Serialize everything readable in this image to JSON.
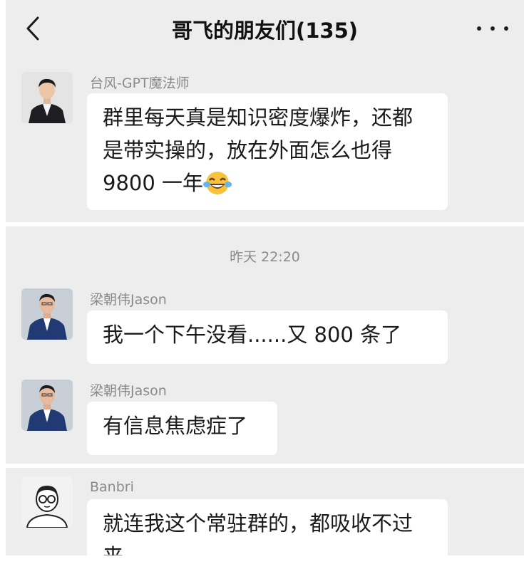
{
  "header": {
    "back_icon": "chevron-left-icon",
    "title": "哥飞的朋友们(135)",
    "more_icon": "more-dots-icon"
  },
  "messages": [
    {
      "sender": "台风-GPT魔法师",
      "avatar": "avatar-man-dark-suit",
      "lines": [
        "群里每天真是知识密度爆炸，还都",
        "是带实操的，放在外面怎么也得",
        "9800 一年"
      ],
      "emoji": "face-with-tears-of-joy-emoji"
    },
    {
      "sender": "梁朝伟Jason",
      "avatar": "avatar-man-blue-suit",
      "lines": [
        "我一个下午没看......又 800 条了"
      ]
    },
    {
      "sender": "梁朝伟Jason",
      "avatar": "avatar-man-blue-suit",
      "lines": [
        "有信息焦虑症了"
      ]
    },
    {
      "sender": "Banbri",
      "avatar": "avatar-cartoon-glasses",
      "lines": [
        "就连我这个常驻群的，都吸收不过",
        "来"
      ]
    }
  ],
  "timestamp": "昨天 22:20",
  "colors": {
    "background": "#ededed",
    "bubble": "#ffffff",
    "sender_text": "#8a8a8a",
    "message_text": "#1a1a1a"
  }
}
